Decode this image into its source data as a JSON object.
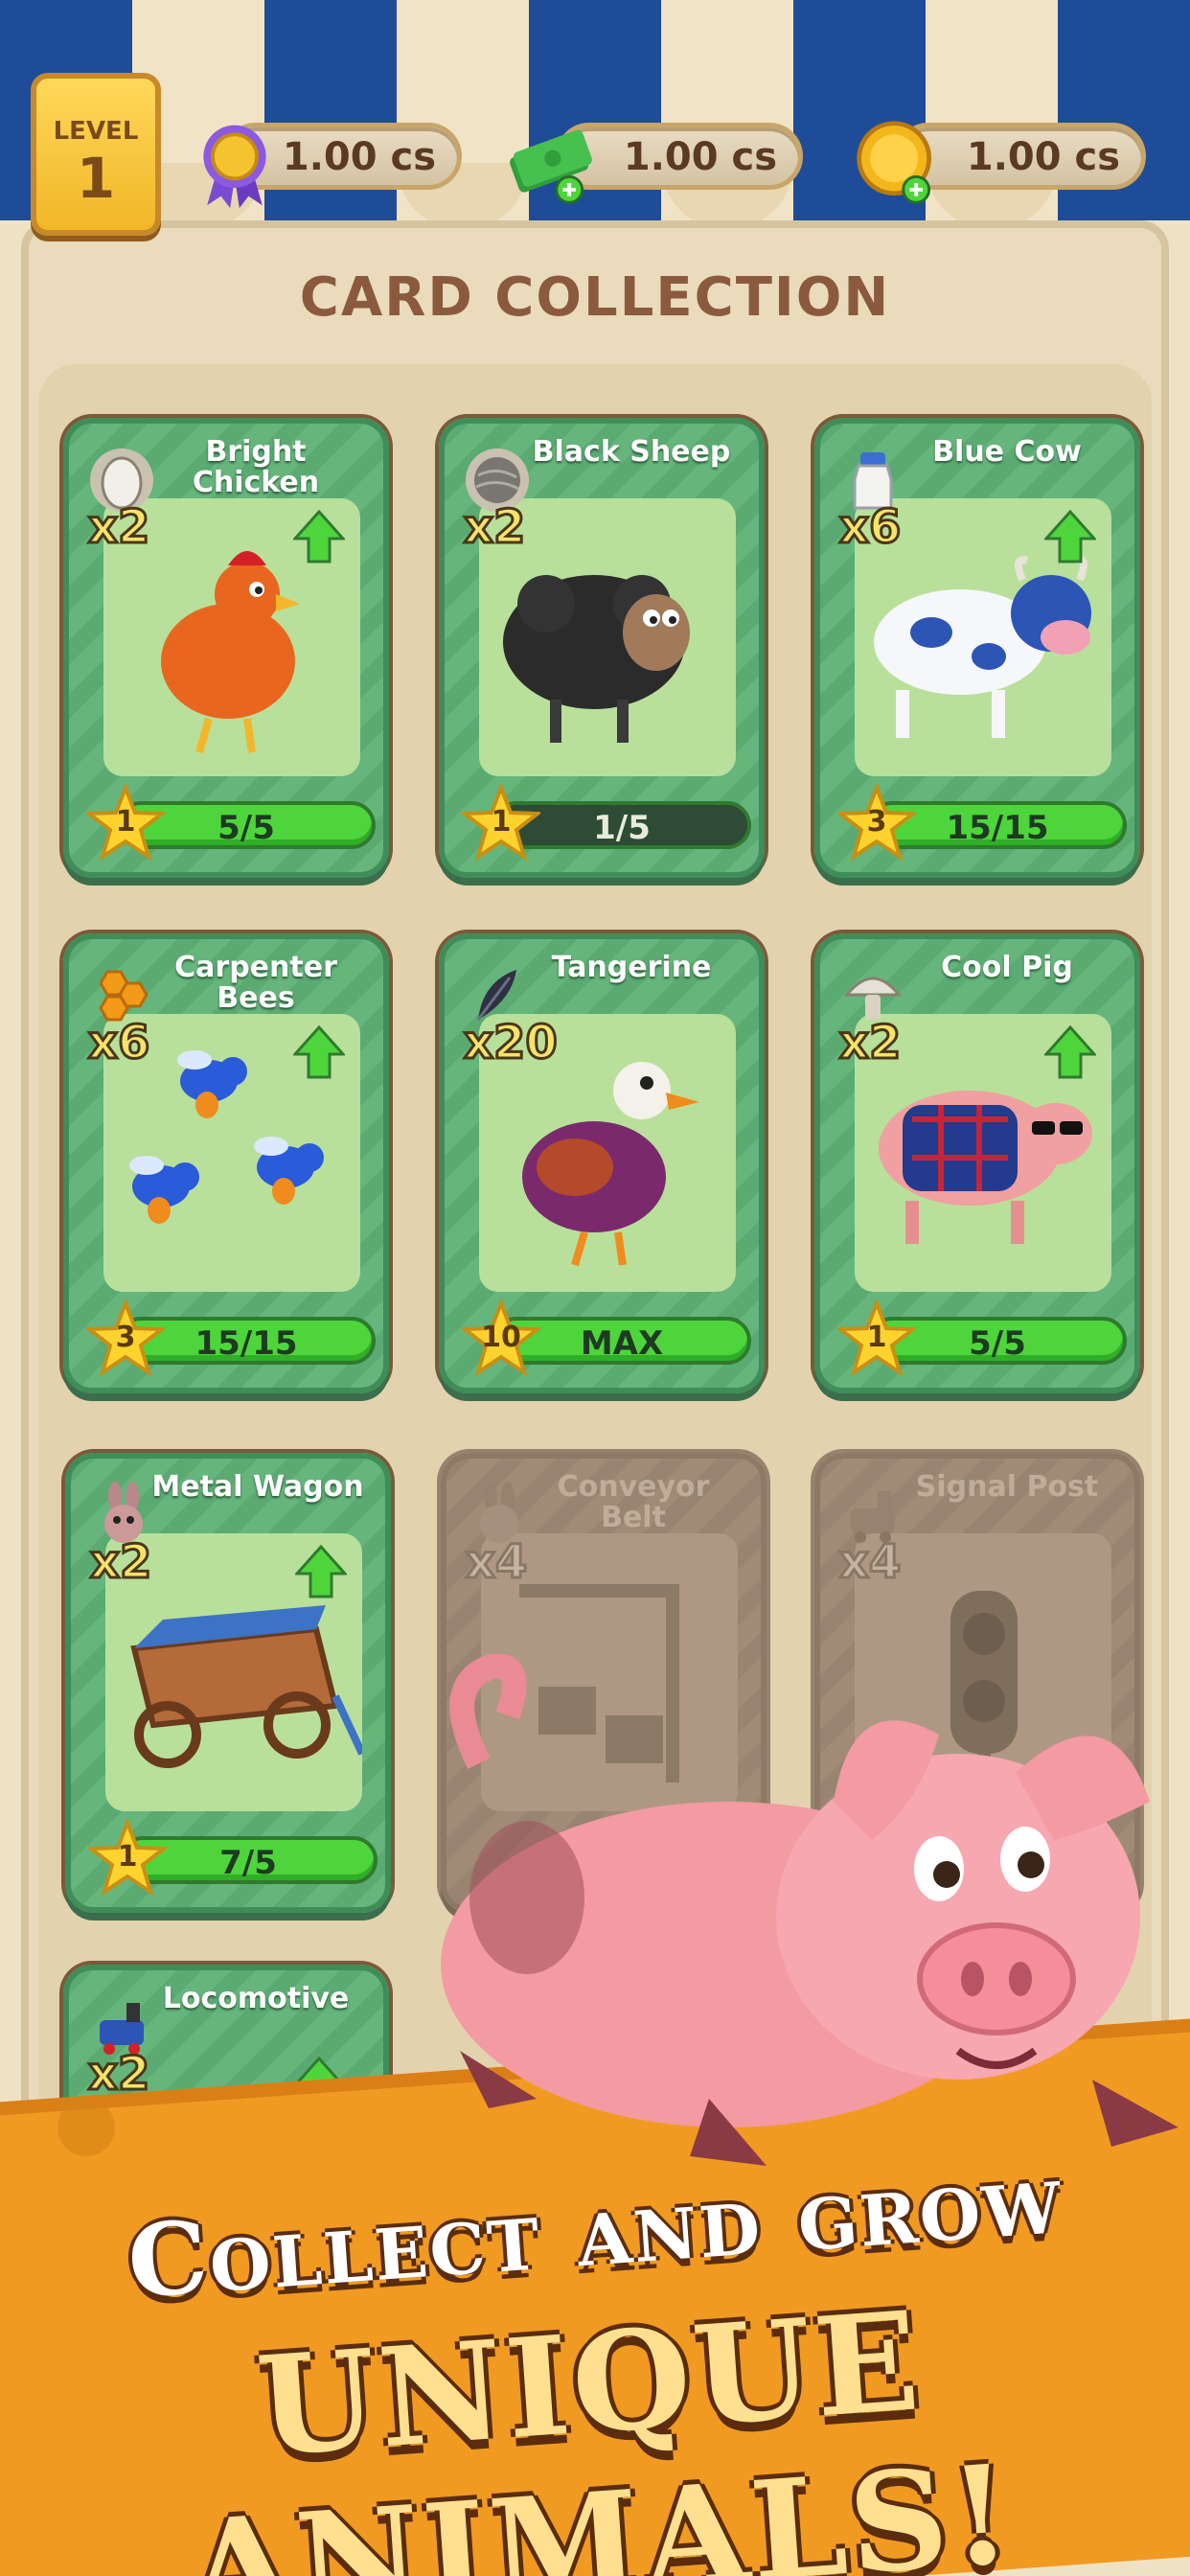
{
  "top_bar": {
    "level_label": "LEVEL",
    "level_value": "1",
    "currencies": [
      {
        "icon": "ribbon-medal-icon",
        "value": "1.00 cs"
      },
      {
        "icon": "cash-stack-plus-icon",
        "value": "1.00 cs"
      },
      {
        "icon": "gold-coin-plus-icon",
        "value": "1.00 cs"
      }
    ]
  },
  "title": "CARD COLLECTION",
  "cards": [
    {
      "name": "Bright\nChicken",
      "resource_icon": "egg-icon",
      "multiplier": "x2",
      "level": "1",
      "progress": "5/5",
      "upgradable": true,
      "locked": false
    },
    {
      "name": "Black Sheep",
      "resource_icon": "wool-ball-icon",
      "multiplier": "x2",
      "level": "1",
      "progress": "1/5",
      "upgradable": false,
      "locked": false
    },
    {
      "name": "Blue Cow",
      "resource_icon": "milk-bottle-icon",
      "multiplier": "x6",
      "level": "3",
      "progress": "15/15",
      "upgradable": true,
      "locked": false
    },
    {
      "name": "Carpenter\nBees",
      "resource_icon": "honeycomb-icon",
      "multiplier": "x6",
      "level": "3",
      "progress": "15/15",
      "upgradable": true,
      "locked": false
    },
    {
      "name": "Tangerine",
      "resource_icon": "feather-icon",
      "multiplier": "x20",
      "level": "10",
      "progress": "MAX",
      "upgradable": false,
      "locked": false
    },
    {
      "name": "Cool Pig",
      "resource_icon": "mushroom-icon",
      "multiplier": "x2",
      "level": "1",
      "progress": "5/5",
      "upgradable": true,
      "locked": false
    },
    {
      "name": "Metal Wagon",
      "resource_icon": "rabbit-icon",
      "multiplier": "x2",
      "level": "1",
      "progress": "7/5",
      "upgradable": true,
      "locked": false
    },
    {
      "name": "Conveyor\nBelt",
      "resource_icon": "rabbit-icon",
      "multiplier": "x4",
      "locked": true
    },
    {
      "name": "Signal Post",
      "resource_icon": "train-icon",
      "multiplier": "x4",
      "locked": true
    },
    {
      "name": "Locomotive",
      "resource_icon": "train-icon",
      "multiplier": "x2",
      "upgradable": true,
      "locked": false
    }
  ],
  "banner": {
    "line1": "Collect and grow",
    "line2": "UNIQUE ANIMALS!"
  },
  "colors": {
    "awning_blue": "#1e4c98",
    "card_green": "#5aaa72",
    "progress_green": "#4fd53c",
    "banner_orange": "#f19a21"
  }
}
